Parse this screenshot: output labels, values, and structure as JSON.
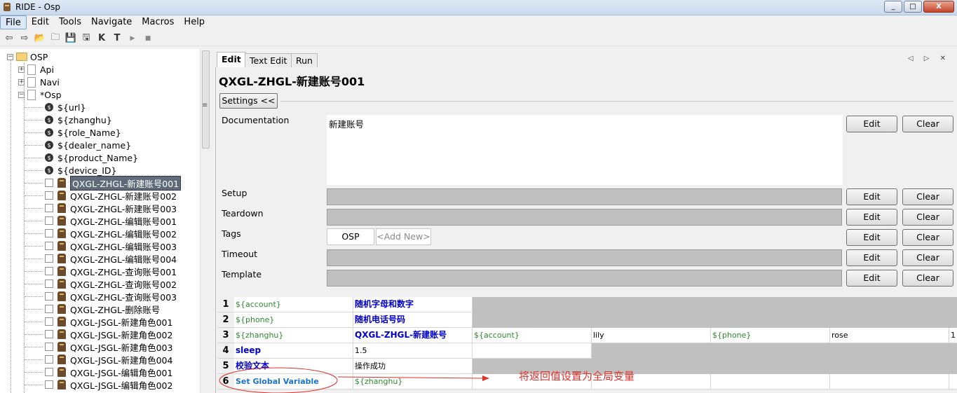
{
  "window": {
    "title": "RIDE - Osp",
    "minimize": "_",
    "maximize": "□",
    "close": "X"
  },
  "menu": [
    "File",
    "Edit",
    "Tools",
    "Navigate",
    "Macros",
    "Help"
  ],
  "toolbar_icons": [
    "back-icon",
    "forward-icon",
    "open-folder-icon",
    "open-directory-icon",
    "save-icon",
    "save-all-icon",
    "keyword-search-icon",
    "test-search-icon",
    "run-icon",
    "stop-icon"
  ],
  "toolbar_glyphs": [
    "⇦",
    "⇨",
    "📂",
    "🗀",
    "💾",
    "🖫",
    "K",
    "T",
    "▶",
    "■"
  ],
  "tree": {
    "root": "OSP",
    "suites": [
      "Api",
      "Navi",
      "*Osp"
    ],
    "variables": [
      "${url}",
      "${zhanghu}",
      "${role_Name}",
      "${dealer_name}",
      "${product_Name}",
      "${device_ID}"
    ],
    "tests": [
      "QXGL-ZHGL-新建账号001",
      "QXGL-ZHGL-新建账号002",
      "QXGL-ZHGL-新建账号003",
      "QXGL-ZHGL-编辑账号001",
      "QXGL-ZHGL-编辑账号002",
      "QXGL-ZHGL-编辑账号003",
      "QXGL-ZHGL-编辑账号004",
      "QXGL-ZHGL-查询账号001",
      "QXGL-ZHGL-查询账号002",
      "QXGL-ZHGL-查询账号003",
      "QXGL-ZHGL-删除账号",
      "QXGL-JSGL-新建角色001",
      "QXGL-JSGL-新建角色002",
      "QXGL-JSGL-新建角色003",
      "QXGL-JSGL-新建角色004",
      "QXGL-JSGL-编辑角色001",
      "QXGL-JSGL-编辑角色002"
    ],
    "selected_index": 0
  },
  "tabs": [
    "Edit",
    "Text Edit",
    "Run"
  ],
  "tab_nav": "◁ ▷ ✕",
  "editor": {
    "title": "QXGL-ZHGL-新建账号001",
    "settings_button": "Settings <<",
    "documentation_label": "Documentation",
    "documentation_value": "新建账号",
    "setup_label": "Setup",
    "teardown_label": "Teardown",
    "tags_label": "Tags",
    "tag_value": "OSP",
    "tag_add": "<Add New>",
    "timeout_label": "Timeout",
    "template_label": "Template",
    "edit_label": "Edit",
    "clear_label": "Clear"
  },
  "steps": [
    {
      "num": "1",
      "cells": [
        "${account}",
        "随机字母和数字"
      ]
    },
    {
      "num": "2",
      "cells": [
        "${phone}",
        "随机电话号码"
      ]
    },
    {
      "num": "3",
      "cells": [
        "${zhanghu}",
        "QXGL-ZHGL-新建账号",
        "${account}",
        "lily",
        "${phone}",
        "rose",
        "1"
      ]
    },
    {
      "num": "4",
      "cells": [
        "sleep",
        "1.5"
      ]
    },
    {
      "num": "5",
      "cells": [
        "校验文本",
        "操作成功"
      ]
    },
    {
      "num": "6",
      "cells": [
        "Set Global Variable",
        "${zhanghu}"
      ]
    }
  ],
  "annotation": "将返回值设置为全局变量",
  "colors": {
    "selection": "#5f6b7a",
    "variable": "#2e8b2e",
    "keyword": "#0000cc",
    "annotation": "#e0312b"
  }
}
